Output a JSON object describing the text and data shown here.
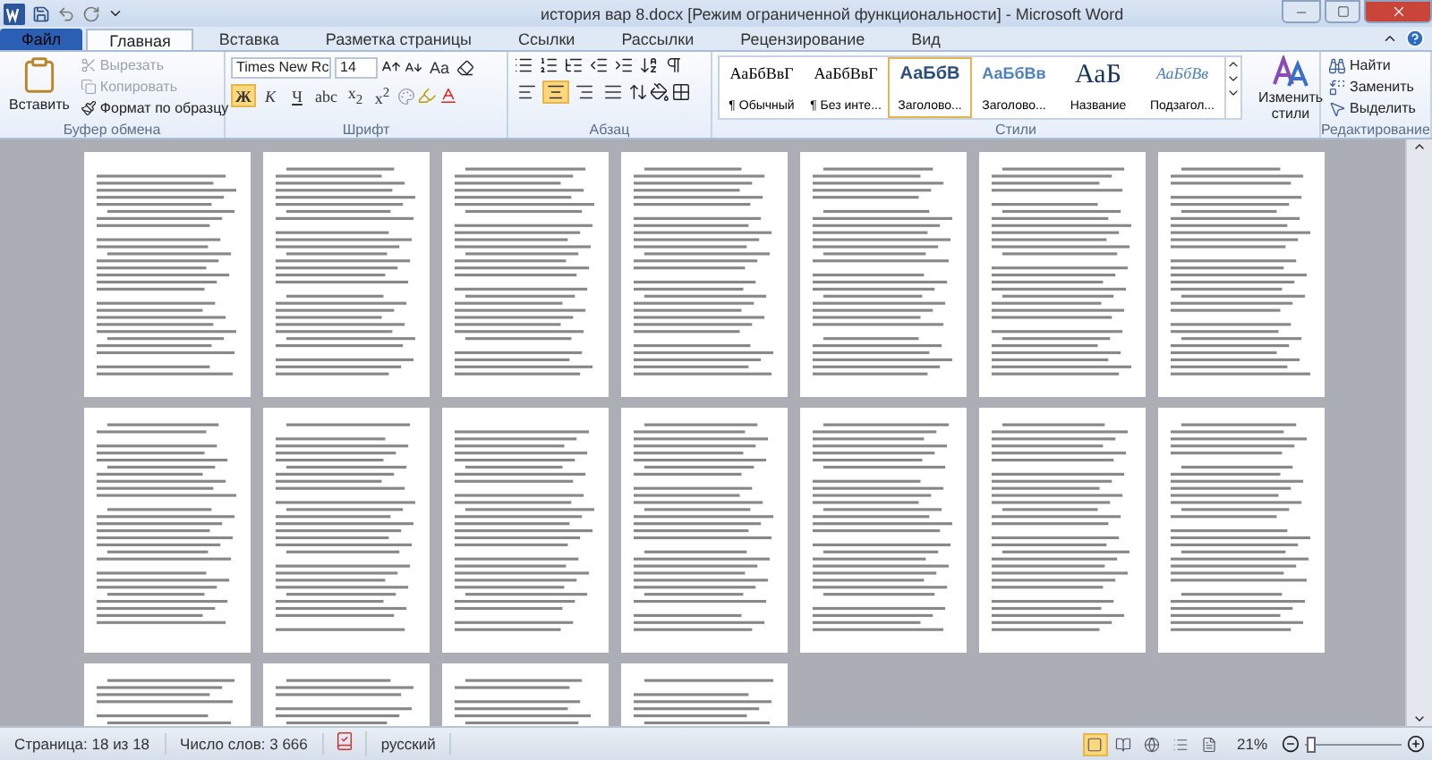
{
  "window": {
    "title": "история вар 8.docx [Режим ограниченной функциональности]  -  Microsoft Word"
  },
  "tabs": [
    {
      "label": "Файл",
      "kind": "file",
      "selected": false
    },
    {
      "label": "Главная",
      "kind": "tab",
      "selected": true
    },
    {
      "label": "Вставка",
      "kind": "tab",
      "selected": false
    },
    {
      "label": "Разметка страницы",
      "kind": "tab",
      "selected": false
    },
    {
      "label": "Ссылки",
      "kind": "tab",
      "selected": false
    },
    {
      "label": "Рассылки",
      "kind": "tab",
      "selected": false
    },
    {
      "label": "Рецензирование",
      "kind": "tab",
      "selected": false
    },
    {
      "label": "Вид",
      "kind": "tab",
      "selected": false
    }
  ],
  "clipboard": {
    "paste": "Вставить",
    "label": "Буфер обмена",
    "items": [
      {
        "label": "Вырезать",
        "kind": "cut",
        "disabled": true
      },
      {
        "label": "Копировать",
        "kind": "copy",
        "disabled": true
      },
      {
        "label": "Формат по образцу",
        "kind": "painter",
        "disabled": false
      }
    ]
  },
  "font": {
    "name": "Times New Rc",
    "size": "14",
    "case_button": "Aa",
    "label": "Шрифт",
    "format_buttons": [
      {
        "label": "Ж",
        "kind": "bold",
        "selected": true
      },
      {
        "label": "К",
        "kind": "italic",
        "selected": false
      },
      {
        "label": "Ч",
        "kind": "underline",
        "selected": false
      },
      {
        "label": "abc",
        "kind": "strike",
        "selected": false
      },
      {
        "label": "x$_{2}$",
        "kind": "sub",
        "selected": false
      },
      {
        "label": "x$^{2}$",
        "kind": "sup",
        "selected": false
      }
    ]
  },
  "paragraph": {
    "label": "Абзац",
    "alignment": [
      {
        "kind": "left",
        "selected": false
      },
      {
        "kind": "center",
        "selected": true
      },
      {
        "kind": "right",
        "selected": false
      },
      {
        "kind": "justify",
        "selected": false
      }
    ]
  },
  "styles": {
    "label": "Стили",
    "change": "Изменить стили",
    "items": [
      {
        "sample": "АаБбВвГ",
        "name": "¶ Обычный",
        "kind": "normal",
        "selected": false
      },
      {
        "sample": "АаБбВвГ",
        "name": "¶ Без инте...",
        "kind": "normal",
        "selected": false
      },
      {
        "sample": "АаБбВ",
        "name": "Заголово...",
        "kind": "heading1",
        "selected": true
      },
      {
        "sample": "АаБбВв",
        "name": "Заголово...",
        "kind": "heading2",
        "selected": false
      },
      {
        "sample": "АаБ",
        "name": "Название",
        "kind": "title",
        "selected": false
      },
      {
        "sample": "АаБбВв",
        "name": "Подзагол...",
        "kind": "subtitle",
        "selected": false
      }
    ]
  },
  "editing": {
    "label": "Редактирование",
    "items": [
      {
        "label": "Найти",
        "kind": "find"
      },
      {
        "label": "Заменить",
        "kind": "replace"
      },
      {
        "label": "Выделить",
        "kind": "select"
      }
    ]
  },
  "pages": [
    {
      "kind": "text"
    },
    {
      "kind": "text"
    },
    {
      "kind": "text"
    },
    {
      "kind": "text"
    },
    {
      "kind": "text"
    },
    {
      "kind": "text"
    },
    {
      "kind": "text"
    },
    {
      "kind": "text"
    },
    {
      "kind": "text"
    },
    {
      "kind": "text"
    },
    {
      "kind": "text"
    },
    {
      "kind": "text"
    },
    {
      "kind": "text"
    },
    {
      "kind": "text"
    },
    {
      "kind": "text"
    },
    {
      "kind": "text"
    },
    {
      "kind": "text"
    },
    {
      "kind": "text"
    }
  ],
  "status_bar": {
    "page": "Страница: 18 из 18",
    "words": "Число слов: 3 666",
    "language": "русский",
    "zoom": "21%",
    "zoom_slider": {
      "level": 0.06
    },
    "views": [
      {
        "kind": "print",
        "selected": true
      },
      {
        "kind": "read",
        "selected": false
      },
      {
        "kind": "web",
        "selected": false
      },
      {
        "kind": "outline",
        "selected": false
      },
      {
        "kind": "draft",
        "selected": false
      }
    ]
  }
}
